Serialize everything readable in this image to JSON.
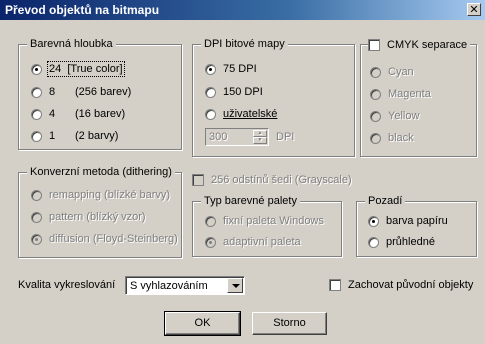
{
  "window": {
    "title": "Převod objektů na bitmapu",
    "close_label": "✕"
  },
  "color_depth": {
    "legend": "Barevná hloubka",
    "options": [
      {
        "key": "24",
        "desc": "[True color]",
        "checked": true
      },
      {
        "key": "8",
        "desc": "(256 barev)",
        "checked": false
      },
      {
        "key": "4",
        "desc": "(16 barev)",
        "checked": false
      },
      {
        "key": "1",
        "desc": "(2 barvy)",
        "checked": false
      }
    ]
  },
  "dpi": {
    "legend": "DPI bitové mapy",
    "options": [
      {
        "label": "75 DPI",
        "checked": true
      },
      {
        "label": "150 DPI",
        "checked": false
      },
      {
        "label": "uživatelské",
        "checked": false
      }
    ],
    "custom_value": "300",
    "custom_unit": "DPI"
  },
  "cmyk": {
    "legend": "CMYK separace",
    "checked": false,
    "options": [
      "Cyan",
      "Magenta",
      "Yellow",
      "black"
    ]
  },
  "dithering": {
    "legend": "Konverzní metoda (dithering)",
    "options": [
      {
        "label": "remapping (blízké barvy)",
        "checked": false
      },
      {
        "label": "pattern (blízký vzor)",
        "checked": false
      },
      {
        "label": "diffusion (Floyd-Steinberg)",
        "checked": true
      }
    ]
  },
  "grayscale": {
    "label": "256 odstínů šedi (Grayscale)",
    "checked": false
  },
  "palette": {
    "legend": "Typ barevné palety",
    "options": [
      {
        "label": "fixní paleta Windows",
        "checked": false
      },
      {
        "label": "adaptivní paleta",
        "checked": true
      }
    ]
  },
  "background": {
    "legend": "Pozadí",
    "options": [
      {
        "label": "barva papíru",
        "checked": true
      },
      {
        "label": "průhledné",
        "checked": false
      }
    ]
  },
  "quality": {
    "label": "Kvalita vykreslování",
    "value": "S vyhlazováním"
  },
  "keep_objects": {
    "label": "Zachovat původní objekty",
    "checked": false
  },
  "buttons": {
    "ok": "OK",
    "cancel": "Storno"
  }
}
